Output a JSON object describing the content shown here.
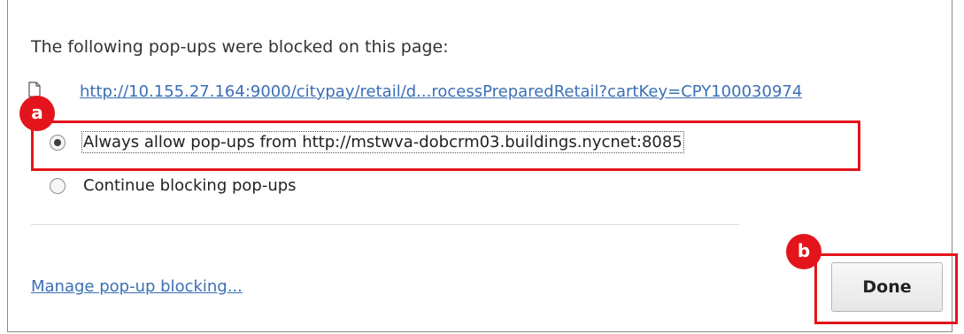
{
  "dialog": {
    "heading": "The following pop-ups were blocked on this page:",
    "blocked_popups": [
      {
        "icon": "document-icon",
        "url_text": "http://10.155.27.164:9000/citypay/retail/d...rocessPreparedRetail?cartKey=CPY100030974"
      }
    ],
    "options": [
      {
        "label": "Always allow pop-ups from http://mstwva-dobcrm03.buildings.nycnet:8085",
        "selected": true
      },
      {
        "label": "Continue blocking pop-ups",
        "selected": false
      }
    ],
    "manage_link": "Manage pop-up blocking...",
    "done_label": "Done"
  },
  "annotations": {
    "color": "#e3141b",
    "a": "a",
    "b": "b"
  }
}
